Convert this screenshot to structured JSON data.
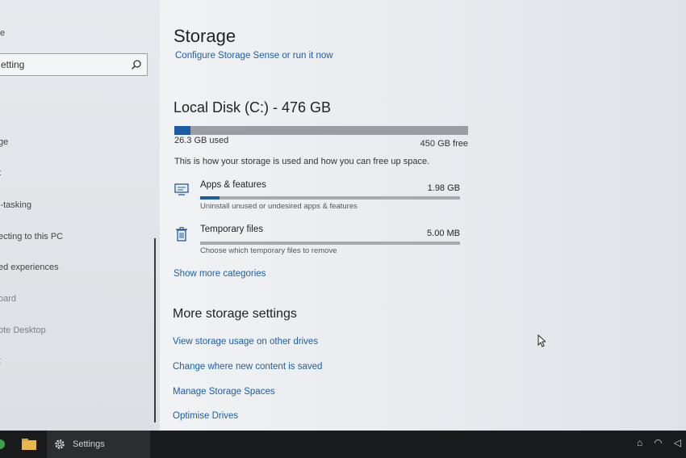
{
  "sidebar": {
    "top_char": "e",
    "search_value": "etting",
    "items": [
      {
        "label": "ge",
        "dim": false
      },
      {
        "label": "t",
        "dim": false
      },
      {
        "label": "i-tasking",
        "dim": false
      },
      {
        "label": "ecting to this PC",
        "dim": false
      },
      {
        "label": "ed experiences",
        "dim": false
      },
      {
        "label": "oard",
        "dim": true
      },
      {
        "label": "ote Desktop",
        "dim": true
      },
      {
        "label": "t",
        "dim": true
      }
    ]
  },
  "main": {
    "title": "Storage",
    "configure_link": "Configure Storage Sense or run it now",
    "disk_title": "Local Disk (C:) - 476 GB",
    "used_label": "26.3 GB used",
    "free_label": "450 GB free",
    "used_fraction": 0.055,
    "intro": "This is how your storage is used and how you can free up space.",
    "categories": [
      {
        "name": "Apps & features",
        "size": "1.98 GB",
        "desc": "Uninstall unused or undesired apps & features",
        "fraction": 0.075,
        "icon": "monitor-icon"
      },
      {
        "name": "Temporary files",
        "size": "5.00 MB",
        "desc": "Choose which temporary files to remove",
        "fraction": 0.0,
        "icon": "trash-icon"
      }
    ],
    "show_more": "Show more categories",
    "more_heading": "More storage settings",
    "more_links": [
      "View storage usage on other drives",
      "Change where new content is saved",
      "Manage Storage Spaces",
      "Optimise Drives"
    ]
  },
  "taskbar": {
    "app_label": "Settings"
  },
  "colors": {
    "accent": "#1c5aa3",
    "link": "#1a5fa8"
  }
}
